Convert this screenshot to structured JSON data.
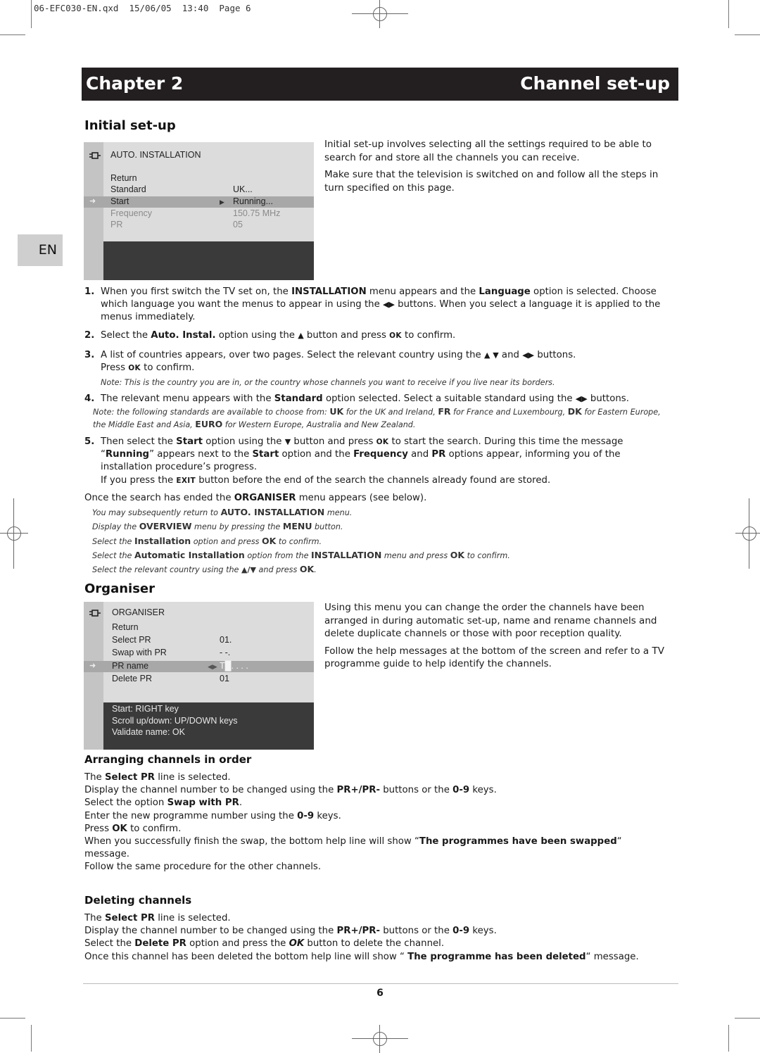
{
  "slug": "06-EFC030-EN.qxd  15/06/05  13:40  Page 6",
  "chapter": {
    "label": "Chapter 2",
    "title": "Channel set-up"
  },
  "language_tab": "EN",
  "initial_setup": {
    "heading": "Initial set-up",
    "menu": {
      "title": "AUTO. INSTALLATION",
      "rows": [
        {
          "key": "Return",
          "value": ""
        },
        {
          "key": "Standard",
          "value": "UK..."
        },
        {
          "key": "Start",
          "value": "Running...",
          "selected": true
        },
        {
          "key": "Frequency",
          "value": "150.75 MHz",
          "dim": true
        },
        {
          "key": "PR",
          "value": "05",
          "dim": true
        }
      ]
    },
    "intro": [
      "Initial set-up involves selecting all the settings required to be able to search for and store all the channels you can receive.",
      "Make sure that the television is switched on and follow all the steps in turn specified on this page."
    ],
    "steps": {
      "s1_num": "1.",
      "s1_a": "When you first switch the TV set on, the ",
      "s1_b": "INSTALLATION",
      "s1_c": " menu appears and the ",
      "s1_d": "Language",
      "s1_e": " option is selected. Choose which language you want the menus to appear in using the ",
      "s1_f": " buttons. When you select a language it is applied to the menus immediately.",
      "s2_num": "2.",
      "s2_a": "Select the ",
      "s2_b": "Auto. Instal.",
      "s2_c": " option using the ",
      "s2_d": " button and press ",
      "s2_e": " to confirm.",
      "s3_num": "3.",
      "s3_a": "A list of countries appears, over two pages. Select the relevant country using the ",
      "s3_b": " and ",
      "s3_c": " buttons.",
      "s3_d": "Press ",
      "s3_e": " to confirm.",
      "s3_note": "Note: This is the country you are in, or the country whose channels you want to receive if you live near its borders.",
      "s4_num": "4.",
      "s4_a": "The relevant menu appears with the ",
      "s4_b": "Standard",
      "s4_c": " option selected. Select a suitable standard using the ",
      "s4_d": " buttons.",
      "s4_note_a": "Note: the following standards are available to choose from: ",
      "s4_uk": "UK",
      "s4_note_b": " for the UK and Ireland, ",
      "s4_fr": "FR",
      "s4_note_c": " for France and Luxembourg, ",
      "s4_dk": "DK",
      "s4_note_d": " for Eastern Europe, the Middle East and Asia, ",
      "s4_euro": "EURO",
      "s4_note_e": " for Western Europe, Australia and New Zealand.",
      "s5_num": "5.",
      "s5_a": "Then select the ",
      "s5_b": "Start",
      "s5_c": " option using the ",
      "s5_d": " button and press ",
      "s5_e": " to start the search. During this time the message “",
      "s5_f": "Running",
      "s5_g": "” appears next to the ",
      "s5_h": "Start",
      "s5_i": " option and the ",
      "s5_j": "Frequency",
      "s5_k": " and ",
      "s5_l": "PR",
      "s5_m": " options appear, informing you of the installation procedure’s progress.",
      "s5_n": "If you press the ",
      "s5_exit": "EXIT",
      "s5_o": " button before the end of the search the channels already found are stored."
    },
    "after": {
      "a": "Once the search has ended the ",
      "b": "ORGANISER",
      "c": " menu appears (see below).",
      "n1_a": "You may subsequently return to ",
      "n1_b": "AUTO. INSTALLATION",
      "n1_c": " menu.",
      "n2_a": "Display the ",
      "n2_b": "OVERVIEW",
      "n2_c": " menu by pressing the ",
      "n2_d": "MENU",
      "n2_e": " button.",
      "n3_a": "Select the ",
      "n3_b": "Installation",
      "n3_c": " option and press ",
      "n3_d": "OK",
      "n3_e": " to confirm.",
      "n4_a": "Select the ",
      "n4_b": "Automatic Installation",
      "n4_c": " option from the ",
      "n4_d": "INSTALLATION",
      "n4_e": " menu and press ",
      "n4_f": "OK",
      "n4_g": " to confirm.",
      "n5_a": "Select the relevant country using the ",
      "n5_b": " and press ",
      "n5_c": "OK",
      "n5_d": "."
    }
  },
  "keys": {
    "ok": "OK",
    "left_right": "◀▶",
    "up": "▲",
    "down": "▼",
    "up_down": "▲ ▼",
    "up_slash_down": "▲/▼"
  },
  "organiser": {
    "heading": "Organiser",
    "menu": {
      "title": "ORGANISER",
      "rows": [
        {
          "key": "Return",
          "value": ""
        },
        {
          "key": "Select PR",
          "value": "01."
        },
        {
          "key": "Swap with PR",
          "value": "- -."
        },
        {
          "key": "PR name",
          "value": "T█. . . .",
          "selected": true
        },
        {
          "key": "Delete PR",
          "value": "01"
        }
      ],
      "help": [
        "Start: RIGHT key",
        "Scroll up/down: UP/DOWN keys",
        "Validate name: OK"
      ]
    },
    "intro": [
      "Using this menu you can change the order the channels have been arranged in during automatic set-up, name and rename channels and delete duplicate channels or those with poor reception quality.",
      "Follow the help messages at the bottom of the screen and refer to a TV programme guide to help identify the channels."
    ]
  },
  "arranging": {
    "heading": "Arranging channels in order",
    "l1_a": "The ",
    "l1_b": "Select PR",
    "l1_c": " line is selected.",
    "l2_a": "Display the channel number to be changed using the ",
    "l2_b": "PR+/PR-",
    "l2_c": " buttons or the ",
    "l2_d": "0-9",
    "l2_e": " keys.",
    "l3_a": "Select the option ",
    "l3_b": "Swap with PR",
    "l3_c": ".",
    "l4_a": "Enter the new programme number using the ",
    "l4_b": "0-9",
    "l4_c": " keys.",
    "l5_a": "Press ",
    "l5_b": "OK",
    "l5_c": " to confirm.",
    "l6_a": "When you successfully finish the swap, the bottom help line will show “",
    "l6_b": "The programmes have been swapped",
    "l6_c": "“",
    "l7": "message.",
    "l8": "Follow the same procedure for the other channels."
  },
  "deleting": {
    "heading": "Deleting channels",
    "l1_a": "The ",
    "l1_b": "Select PR",
    "l1_c": " line is selected.",
    "l2_a": "Display the channel number to be changed using the ",
    "l2_b": "PR+/PR-",
    "l2_c": " buttons or the ",
    "l2_d": "0-9",
    "l2_e": " keys.",
    "l3_a": "Select the ",
    "l3_b": "Delete PR",
    "l3_c": " option and press the ",
    "l3_d": "OK",
    "l3_e": " button to delete the channel.",
    "l4_a": "Once this channel has been deleted the bottom help line will show “ ",
    "l4_b": "The programme has been deleted",
    "l4_c": "“ message."
  },
  "page_number": "6"
}
